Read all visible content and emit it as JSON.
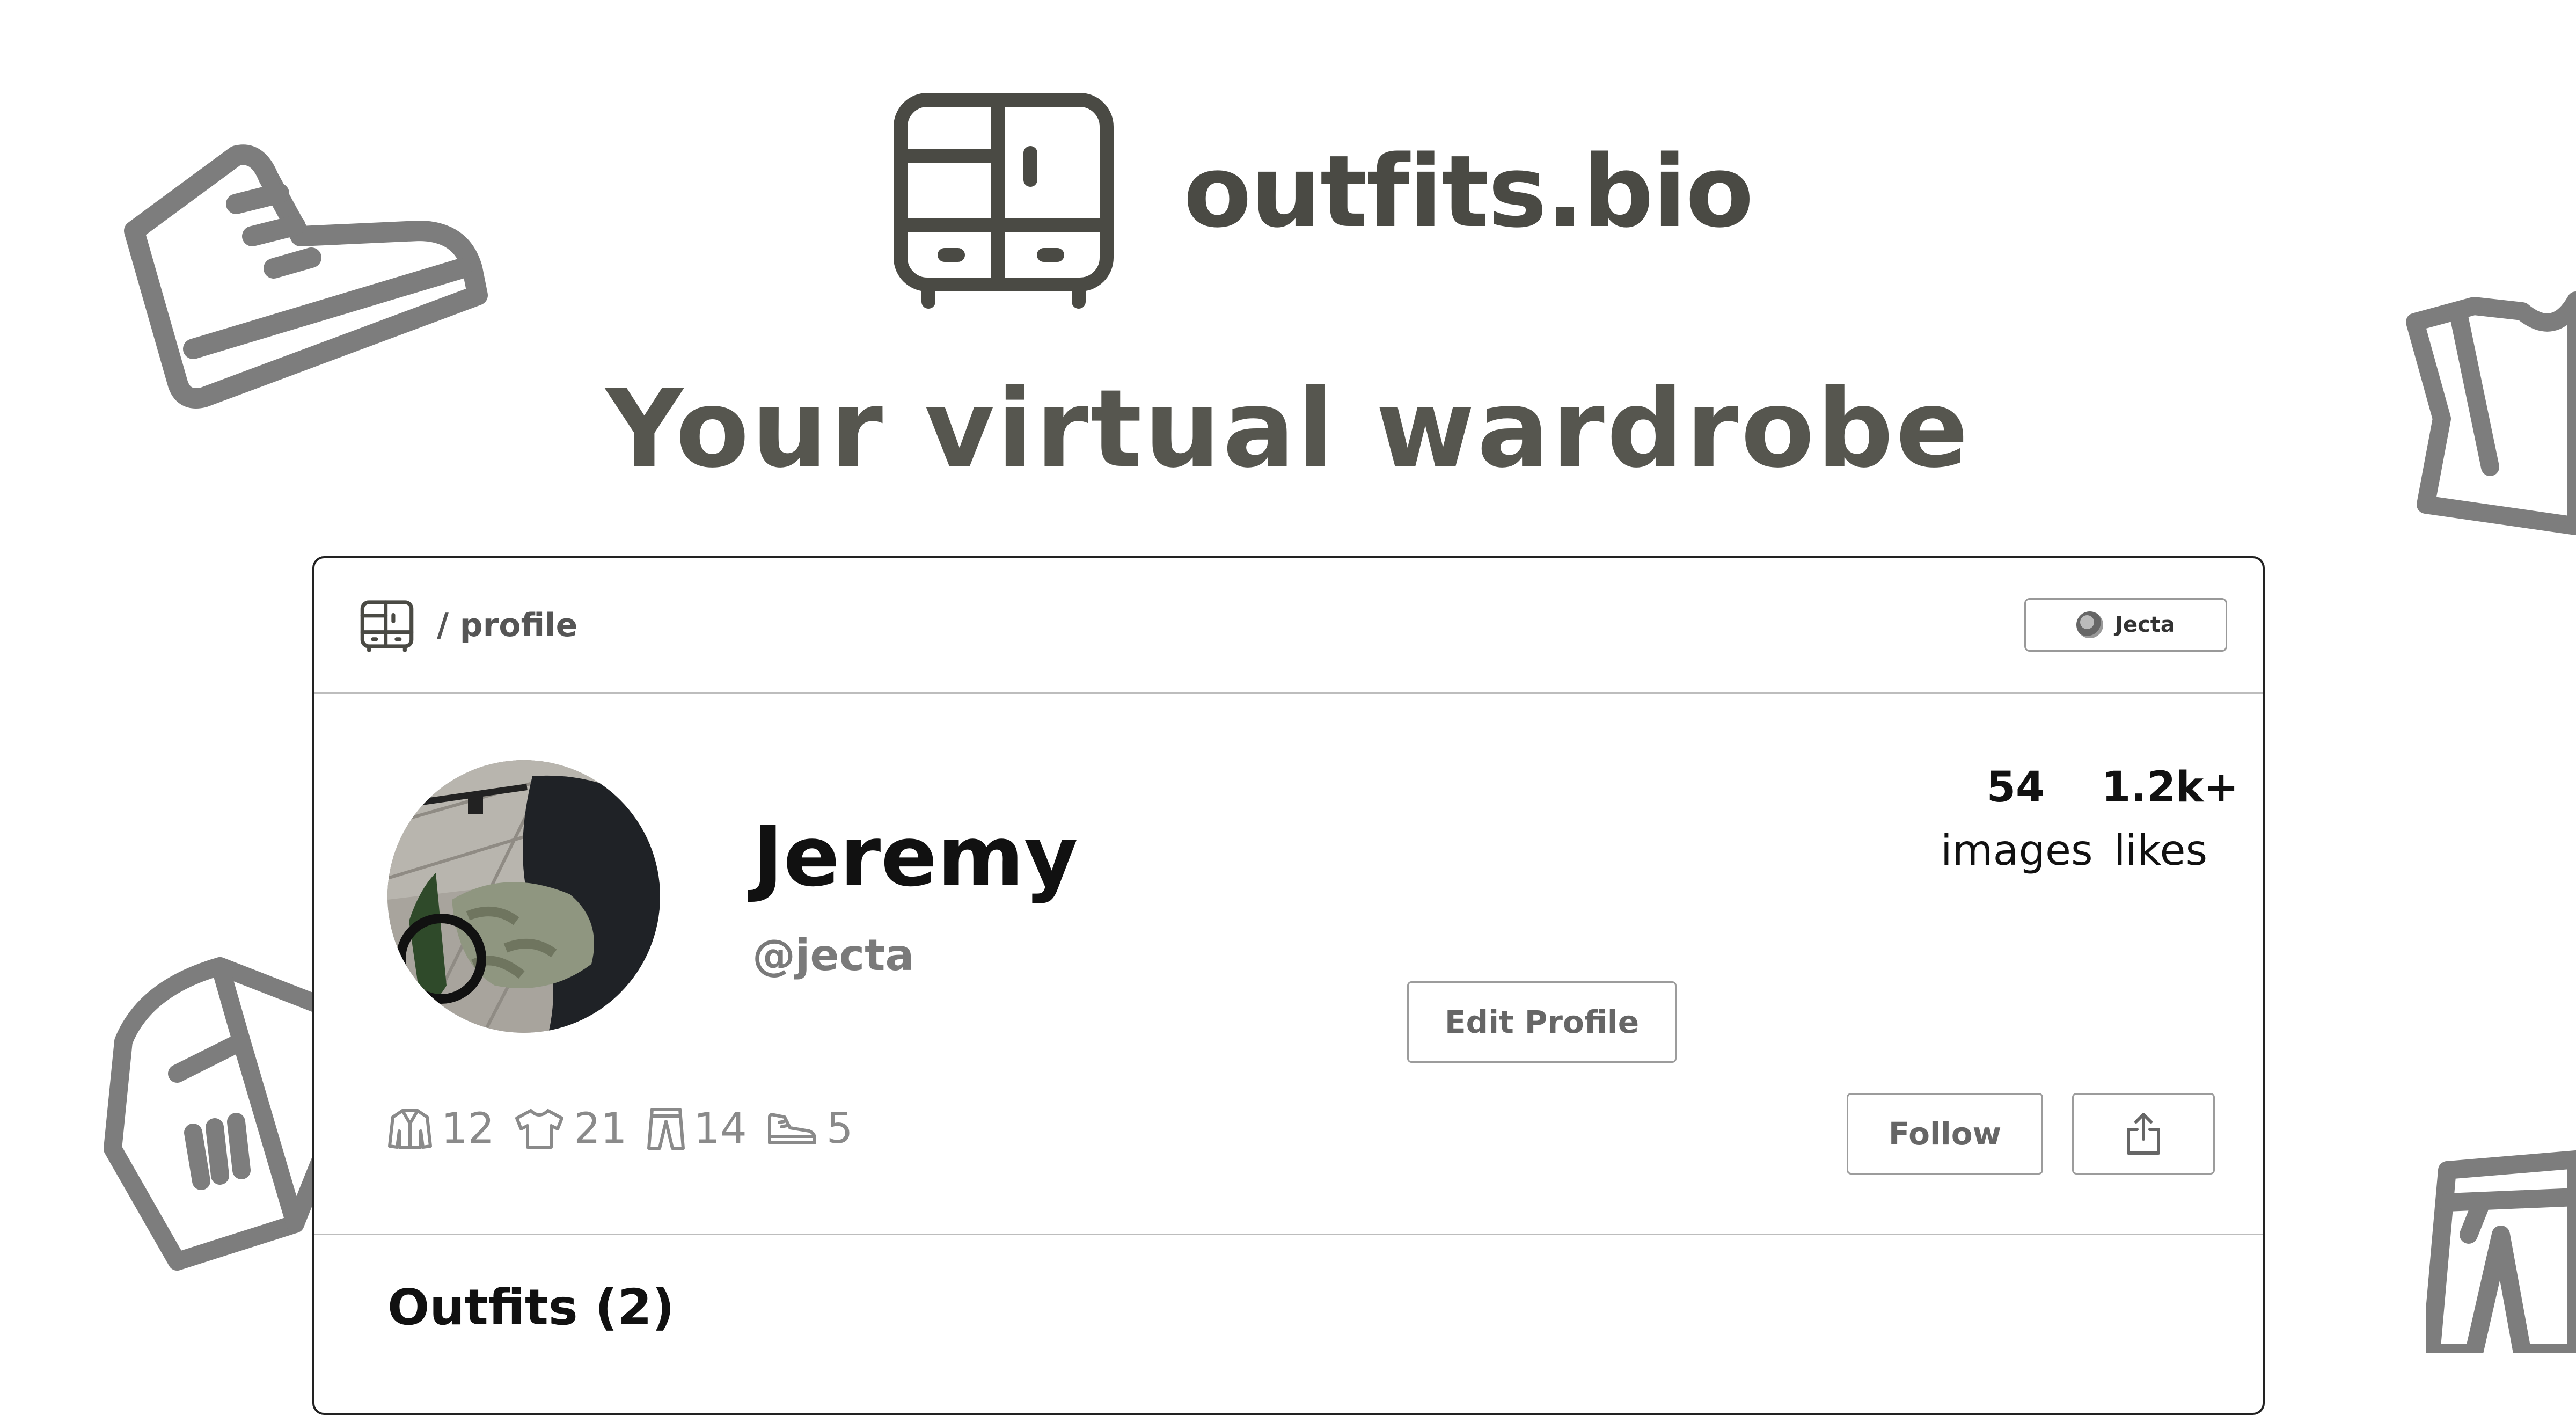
{
  "hero": {
    "brand": "outfits.bio",
    "tagline": "Your virtual wardrobe"
  },
  "app": {
    "breadcrumb": "/ profile",
    "user_chip": "Jecta"
  },
  "profile": {
    "name": "Jeremy",
    "handle": "@jecta",
    "images_count": "54",
    "images_label": "images",
    "likes_count": "1.2k+",
    "likes_label": "likes",
    "edit_label": "Edit Profile",
    "follow_label": "Follow",
    "counts": {
      "jackets": "12",
      "shirts": "21",
      "pants": "14",
      "shoes": "5"
    }
  },
  "outfits": {
    "title": "Outfits (2)"
  },
  "icons": [
    "wardrobe-icon",
    "sneaker-icon",
    "tshirt-icon",
    "jacket-icon",
    "pants-icon",
    "share-icon"
  ],
  "colors": {
    "brand_text": "#4a4a44",
    "decoration": "#7d7d7d",
    "card_border": "#222222"
  }
}
